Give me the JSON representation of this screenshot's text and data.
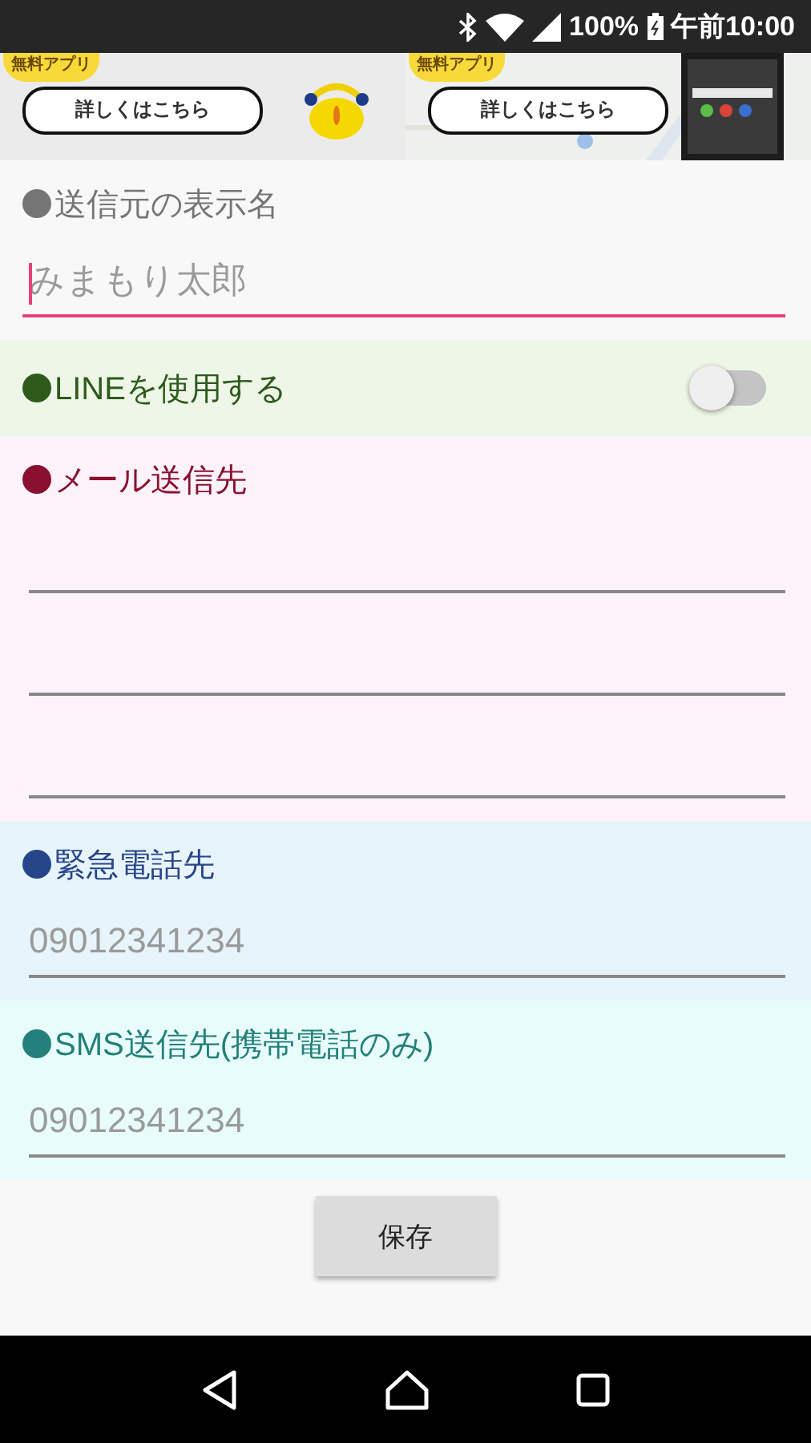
{
  "status_bar": {
    "battery": "100%",
    "time": "午前10:00"
  },
  "ads": [
    {
      "kind": "mascot",
      "badge": "無料アプリ",
      "button": "詳しくはこちら"
    },
    {
      "kind": "map",
      "badge": "無料アプリ",
      "button": "詳しくはこちら"
    }
  ],
  "sections": [
    {
      "kind": "text",
      "label": "送信元の表示名",
      "color": "#757575",
      "fields": [
        {
          "placeholder": "みまもり太郎",
          "focused": true
        }
      ]
    },
    {
      "kind": "switch",
      "label": "LINEを使用する",
      "color": "#2e5a1c",
      "on": false
    },
    {
      "kind": "text",
      "label": "メール送信先",
      "color": "#8a1030",
      "fields": [
        {
          "focused": false
        },
        {
          "focused": false
        },
        {
          "focused": false
        }
      ]
    },
    {
      "kind": "text",
      "label": "緊急電話先",
      "color": "#27468a",
      "fields": [
        {
          "placeholder": "09012341234",
          "focused": false
        }
      ]
    },
    {
      "kind": "text",
      "label": "SMS送信先(携帯電話のみ)",
      "color": "#23807a",
      "fields": [
        {
          "placeholder": "09012341234",
          "focused": false
        }
      ]
    }
  ],
  "save_button": "保存"
}
